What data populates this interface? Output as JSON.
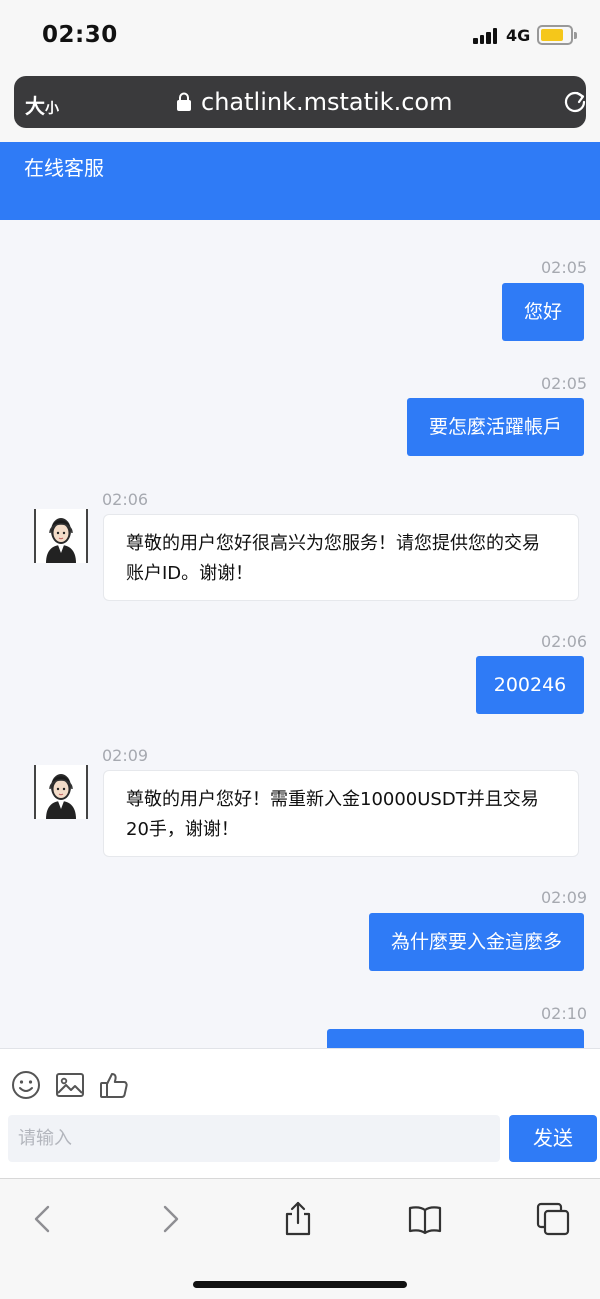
{
  "status_bar": {
    "time": "02:30",
    "network": "4G"
  },
  "browser": {
    "text_size": "大",
    "text_size_small": "小",
    "url": "chatlink.mstatik.com"
  },
  "header": {
    "title": "在线客服"
  },
  "messages": [
    {
      "direction": "out",
      "time": "02:05",
      "text": "您好"
    },
    {
      "direction": "out",
      "time": "02:05",
      "text": "要怎麼活躍帳戶"
    },
    {
      "direction": "in",
      "time": "02:06",
      "text": "尊敬的用户您好很高兴为您服务！请您提供您的交易账户ID。谢谢！"
    },
    {
      "direction": "out",
      "time": "02:06",
      "text": "200246"
    },
    {
      "direction": "in",
      "time": "02:09",
      "text": "尊敬的用户您好！需重新入金10000USDT并且交易20手，谢谢！"
    },
    {
      "direction": "out",
      "time": "02:09",
      "text": "為什麼要入金這麼多"
    },
    {
      "direction": "out",
      "time": "02:10",
      "text": ""
    }
  ],
  "composer": {
    "placeholder": "请输入",
    "send_label": "发送",
    "tools": [
      "emoji-icon",
      "image-icon",
      "thumbs-up-icon"
    ]
  },
  "toolbar": {
    "icons": [
      "back-icon",
      "forward-icon",
      "share-icon",
      "bookmarks-icon",
      "tabs-icon"
    ]
  },
  "colors": {
    "accent": "#2f7bf6",
    "background": "#f5f6fa",
    "timestamp": "#a6a9b0"
  }
}
